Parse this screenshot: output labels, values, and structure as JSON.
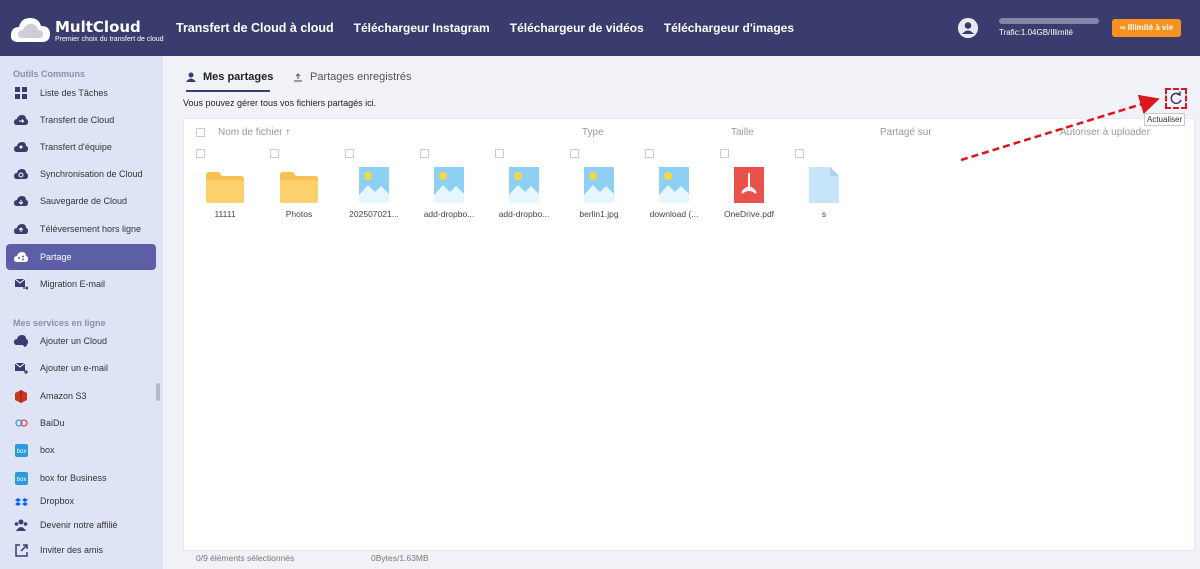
{
  "app": {
    "brand": "MultCloud",
    "tagline": "Premier choix du transfert de cloud"
  },
  "nav": {
    "items": [
      "Transfert de Cloud à cloud",
      "Téléchargeur Instagram",
      "Téléchargeur de vidéos",
      "Téléchargeur d'images"
    ]
  },
  "header": {
    "traffic": "Trafic:1.04GB/Illimité",
    "upgrade": "Illimité à vie"
  },
  "sidebar": {
    "section1": "Outils Communs",
    "tools": [
      "Liste des Tâches",
      "Transfert de Cloud",
      "Transfert d'équipe",
      "Synchronisation de Cloud",
      "Sauvegarde de Cloud",
      "Téléversement hors ligne",
      "Partage",
      "Migration E-mail"
    ],
    "section2": "Mes services en ligne",
    "services": [
      "Ajouter un Cloud",
      "Ajouter un e-mail",
      "Amazon S3",
      "BaiDu",
      "box",
      "box for Business",
      "Dropbox"
    ],
    "bottom": [
      "Devenir notre affilié",
      "Inviter des amis"
    ]
  },
  "tabs": {
    "mine": "Mes partages",
    "saved": "Partages enregistrés"
  },
  "description": "Vous pouvez gérer tous vos fichiers partagés ici.",
  "columns": {
    "name": "Nom de fichier",
    "sort_icon": "↑",
    "type": "Type",
    "size": "Taille",
    "shared_on": "Partagé sur",
    "allow_upload": "Autoriser à uploader"
  },
  "files": [
    {
      "name": "11111",
      "kind": "folder"
    },
    {
      "name": "Photos",
      "kind": "folder"
    },
    {
      "name": "202507021...",
      "kind": "image"
    },
    {
      "name": "add-dropbo...",
      "kind": "image"
    },
    {
      "name": "add-dropbo...",
      "kind": "image"
    },
    {
      "name": "berlin1.jpg",
      "kind": "image"
    },
    {
      "name": "download (...",
      "kind": "image"
    },
    {
      "name": "OneDrive.pdf",
      "kind": "pdf"
    },
    {
      "name": "s",
      "kind": "file"
    }
  ],
  "refresh_tooltip": "Actualiser",
  "footer": {
    "selected": "0/9 éléments sélectionnés",
    "usage": "0Bytes/1.63MB"
  },
  "colors": {
    "topbar": "#3a3c6e",
    "accent": "#f7921e",
    "active": "#5d5fa6",
    "highlight": "#d9181e"
  }
}
